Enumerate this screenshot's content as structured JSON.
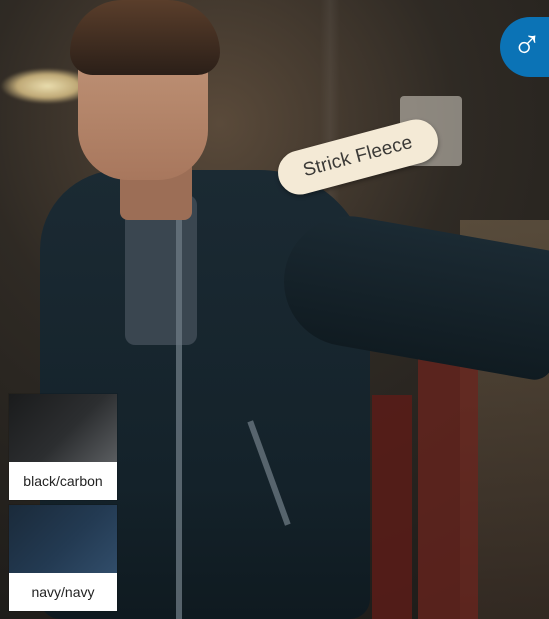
{
  "badge": {
    "text": "Strick Fleece"
  },
  "gender_icon": {
    "symbol": "♂",
    "name": "male-symbol-icon",
    "color": "#0b73b6"
  },
  "swatches": [
    {
      "label": "black/carbon"
    },
    {
      "label": "navy/navy"
    }
  ]
}
